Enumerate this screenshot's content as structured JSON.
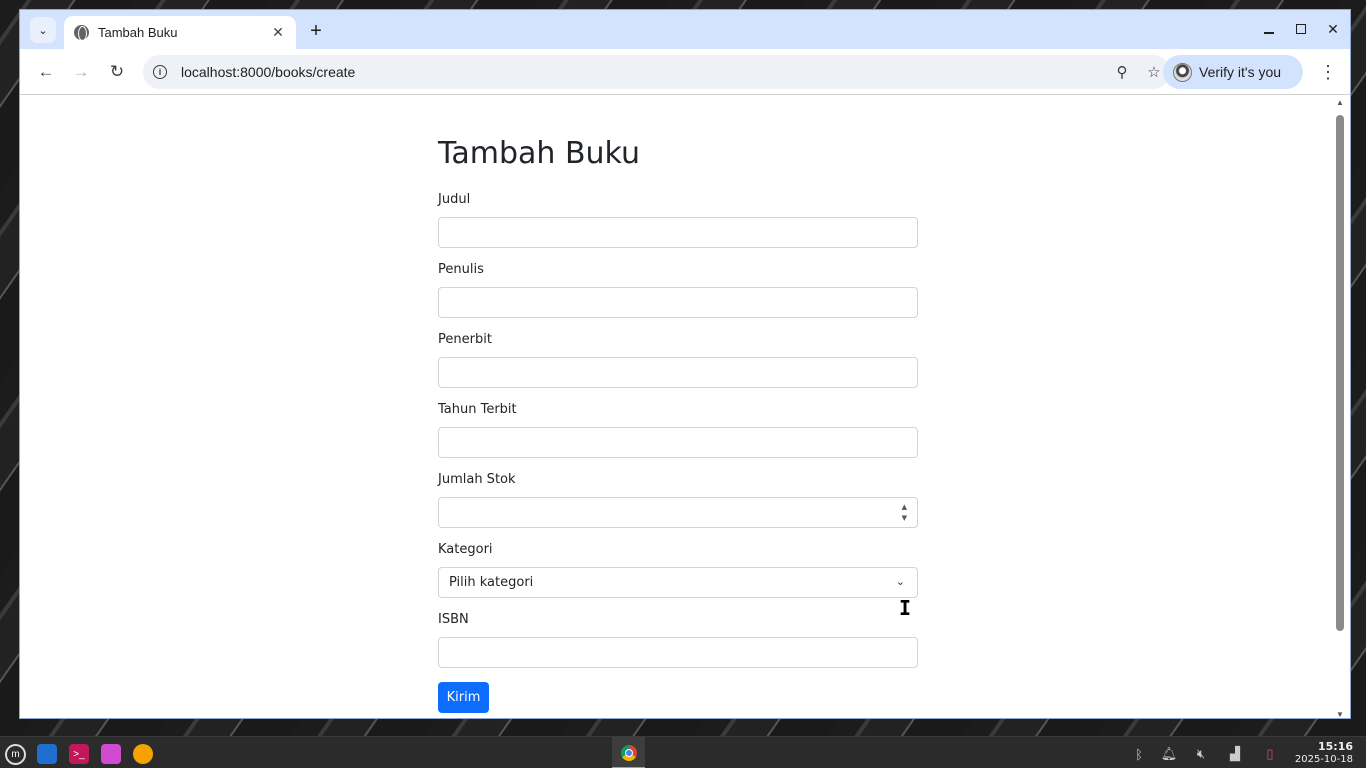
{
  "browser": {
    "tab_title": "Tambah Buku",
    "new_tab_label": "+",
    "url": "localhost:8000/books/create",
    "verify_label": "Verify it's you"
  },
  "page": {
    "title": "Tambah Buku",
    "fields": [
      {
        "label": "Judul",
        "value": "",
        "type": "text"
      },
      {
        "label": "Penulis",
        "value": "",
        "type": "text"
      },
      {
        "label": "Penerbit",
        "value": "",
        "type": "text"
      },
      {
        "label": "Tahun Terbit",
        "value": "",
        "type": "text"
      },
      {
        "label": "Jumlah Stok",
        "value": "",
        "type": "number"
      },
      {
        "label": "Kategori",
        "value": "Pilih kategori",
        "type": "select"
      },
      {
        "label": "ISBN",
        "value": "",
        "type": "text"
      }
    ],
    "submit_label": "Kirim"
  },
  "taskbar": {
    "time": "15:16",
    "date": "2025-10-18"
  },
  "colors": {
    "primary_button": "#0d6efd",
    "tab_strip": "#d3e3fd",
    "taskbar": "#2b2b2b"
  },
  "icons": [
    "tab-search-icon",
    "globe-icon",
    "close-icon",
    "back-icon",
    "forward-icon",
    "reload-icon",
    "site-info-icon",
    "zoom-icon",
    "bookmark-star-icon",
    "profile-avatar-icon",
    "kebab-menu-icon",
    "mint-menu-icon",
    "desktop-icon",
    "terminal-icon",
    "files-icon",
    "firefox-icon",
    "chrome-icon",
    "bluetooth-icon",
    "notifications-icon",
    "volume-muted-icon",
    "network-icon",
    "battery-icon"
  ]
}
